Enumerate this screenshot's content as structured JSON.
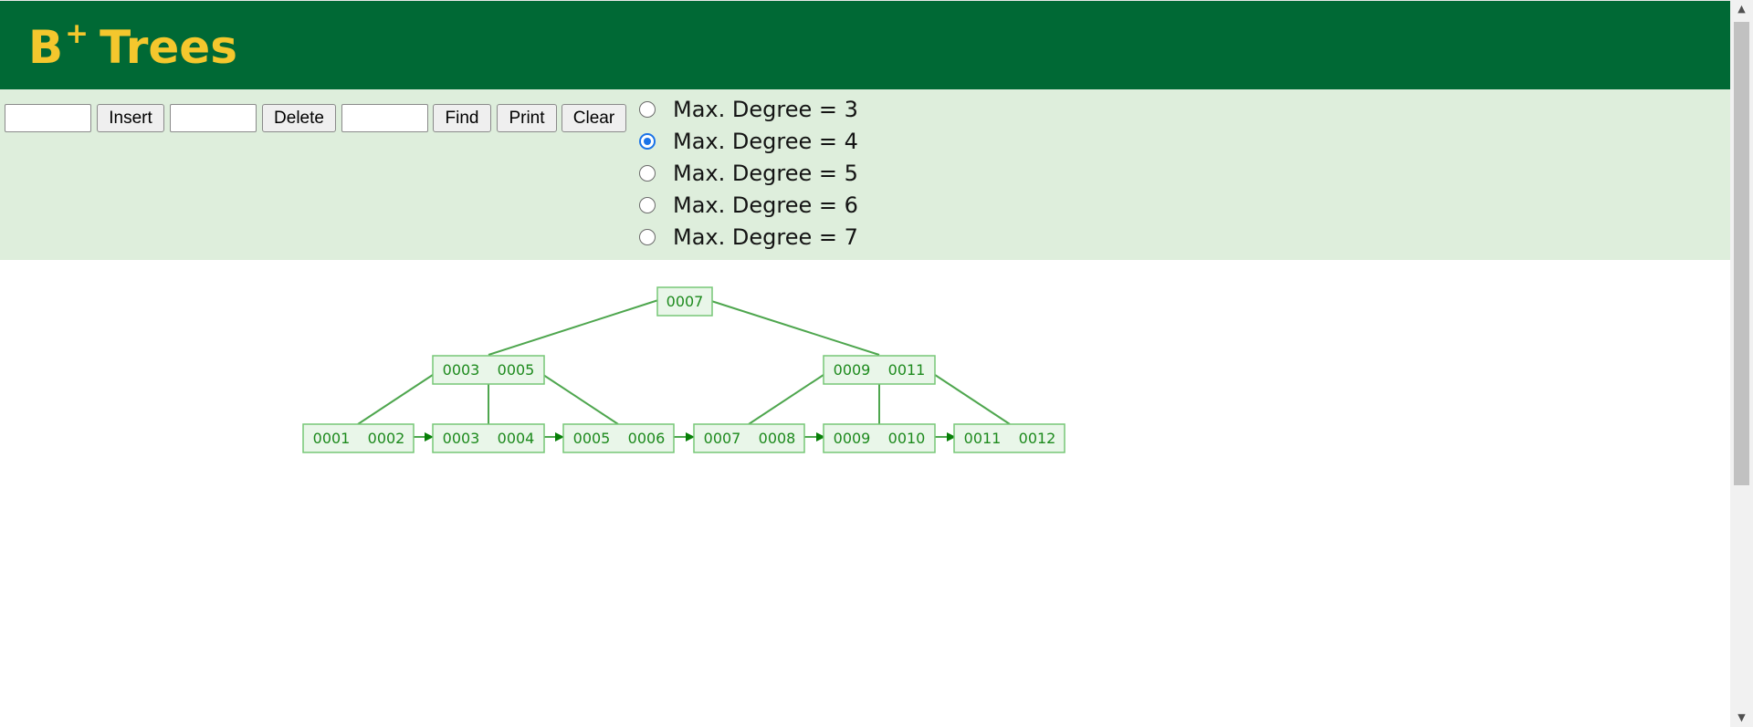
{
  "header": {
    "title_letter": "B",
    "title_sup": "+",
    "title_rest": "Trees"
  },
  "toolbar": {
    "insert_value": "",
    "insert_label": "Insert",
    "delete_value": "",
    "delete_label": "Delete",
    "find_value": "",
    "find_label": "Find",
    "print_label": "Print",
    "clear_label": "Clear"
  },
  "degree_options": [
    {
      "label": "Max. Degree = 3",
      "checked": false
    },
    {
      "label": "Max. Degree = 4",
      "checked": true
    },
    {
      "label": "Max. Degree = 5",
      "checked": false
    },
    {
      "label": "Max. Degree = 6",
      "checked": false
    },
    {
      "label": "Max. Degree = 7",
      "checked": false
    }
  ],
  "tree": {
    "root": [
      "0007"
    ],
    "internal": [
      [
        "0003",
        "0005"
      ],
      [
        "0009",
        "0011"
      ]
    ],
    "leaves": [
      [
        "0001",
        "0002"
      ],
      [
        "0003",
        "0004"
      ],
      [
        "0005",
        "0006"
      ],
      [
        "0007",
        "0008"
      ],
      [
        "0009",
        "0010"
      ],
      [
        "0011",
        "0012"
      ]
    ]
  },
  "colors": {
    "header_bg": "#006935",
    "title": "#f4c72d",
    "panel_bg": "#deeedc",
    "node_fill": "#e9f6e9",
    "node_stroke": "#77c777",
    "key_text": "#1d8a1d",
    "edge": "#4ea64e",
    "arrow": "#087f08"
  }
}
